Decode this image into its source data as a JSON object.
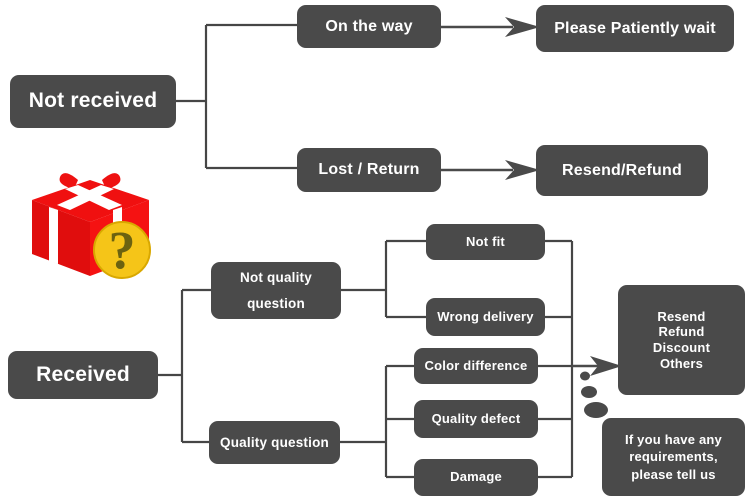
{
  "diagram": {
    "title": "Order status support flowchart",
    "colors": {
      "node_fill": "#4a4a4a",
      "node_text": "#ffffff",
      "wire": "#464646",
      "background": "#ffffff",
      "gift_red": "#ee1111",
      "gift_ribbon": "#ffffff",
      "badge_yellow": "#f5c518",
      "badge_mark": "#6b6210"
    },
    "icons": {
      "gift": "gift-box-question-icon",
      "bubble_tail": "speech-bubble-tail-dots"
    }
  },
  "nodes": {
    "not_received": {
      "label": "Not received"
    },
    "on_the_way": {
      "label": "On the way"
    },
    "please_wait": {
      "label": "Please Patiently wait"
    },
    "lost_return": {
      "label": "Lost / Return"
    },
    "resend_refund": {
      "label": "Resend/Refund"
    },
    "received": {
      "label": "Received"
    },
    "not_quality_question": {
      "line1": "Not quality",
      "line2": "question"
    },
    "quality_question": {
      "label": "Quality question"
    },
    "not_fit": {
      "label": "Not fit"
    },
    "wrong_delivery": {
      "label": "Wrong delivery"
    },
    "color_difference": {
      "label": "Color difference"
    },
    "quality_defect": {
      "label": "Quality defect"
    },
    "damage": {
      "label": "Damage"
    },
    "outcomes": {
      "line1": "Resend",
      "line2": "Refund",
      "line3": "Discount",
      "line4": "Others"
    },
    "contact_note": {
      "line1": "If you have any",
      "line2": "requirements,",
      "line3": "please tell us"
    }
  }
}
